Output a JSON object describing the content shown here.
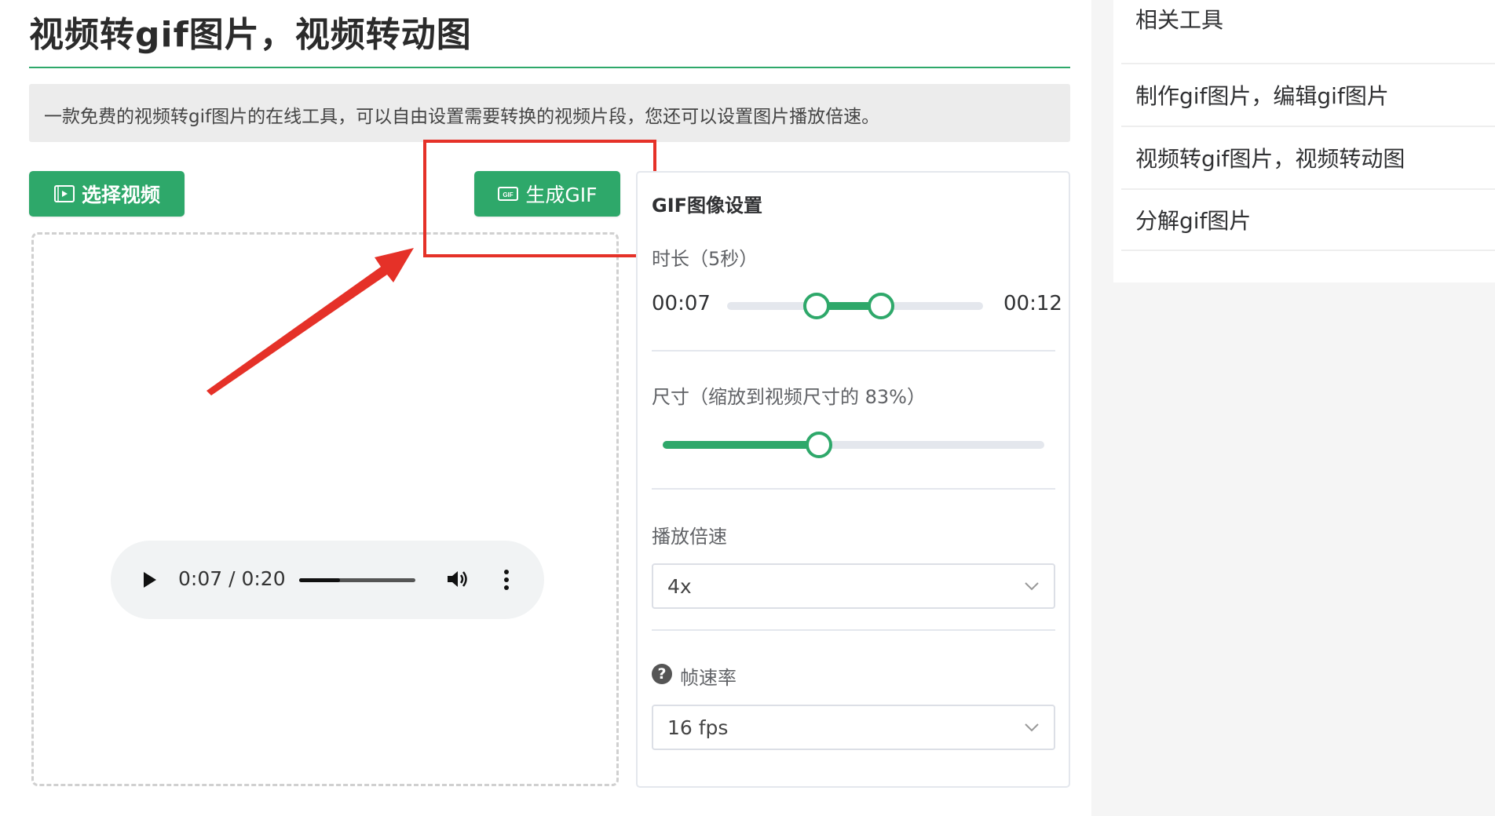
{
  "page": {
    "title": "视频转gif图片，视频转动图",
    "description": "一款免费的视频转gif图片的在线工具，可以自由设置需要转换的视频片段，您还可以设置图片播放倍速。"
  },
  "toolbar": {
    "select_video_label": "选择视频",
    "generate_gif_label": "生成GIF"
  },
  "player": {
    "time": "0:07 / 0:20",
    "progress": 0.35
  },
  "settings": {
    "title": "GIF图像设置",
    "duration_label": "时长（5秒）",
    "range_start": "00:07",
    "range_end": "00:12",
    "range_start_fraction": 0.35,
    "range_end_fraction": 0.6,
    "size_label": "尺寸（缩放到视频尺寸的 83%）",
    "size_fraction": 0.41,
    "speed_label": "播放倍速",
    "speed_value": "4x",
    "fps_label": "帧速率",
    "fps_value": "16 fps"
  },
  "sidebar": {
    "title": "相关工具",
    "links": [
      {
        "label": "制作gif图片，编辑gif图片"
      },
      {
        "label": "视频转gif图片，视频转动图"
      },
      {
        "label": "分解gif图片"
      }
    ]
  },
  "colors": {
    "accent": "#2ea86a",
    "annotation": "#e53128"
  }
}
